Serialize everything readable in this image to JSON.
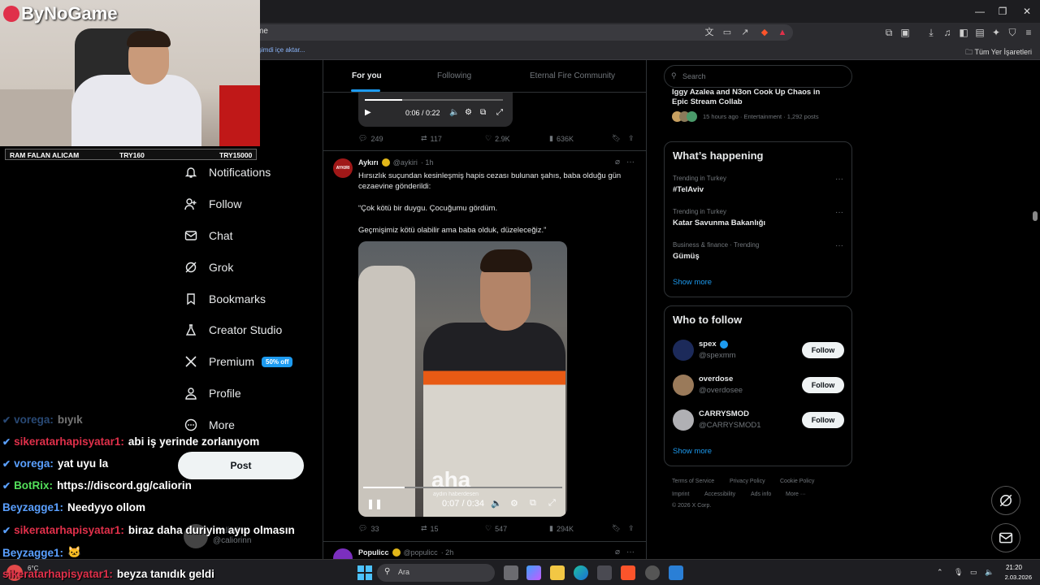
{
  "browser": {
    "address_text": "me",
    "bookmark_import": "şimdi içe aktar...",
    "all_bookmarks": "Tüm Yer İşaretleri",
    "window_controls": [
      "minimize-icon",
      "maximize-icon",
      "close-icon"
    ]
  },
  "webcam": {
    "logo": "ByNoGame",
    "ticker_left": "RAM FALAN ALICAM",
    "ticker_mid": "TRY160",
    "ticker_right": "TRY15000"
  },
  "nav": {
    "items": [
      {
        "label": "Notifications",
        "icon": "bell-icon"
      },
      {
        "label": "Follow",
        "icon": "person-add-icon"
      },
      {
        "label": "Chat",
        "icon": "mail-icon"
      },
      {
        "label": "Grok",
        "icon": "grok-icon"
      },
      {
        "label": "Bookmarks",
        "icon": "bookmark-icon"
      },
      {
        "label": "Creator Studio",
        "icon": "flask-icon"
      },
      {
        "label": "Premium",
        "icon": "x-logo-icon",
        "badge": "50% off"
      },
      {
        "label": "Profile",
        "icon": "person-icon"
      },
      {
        "label": "More",
        "icon": "more-circle-icon"
      }
    ],
    "post_label": "Post",
    "account_name": "Caliorinn",
    "account_handle": "@caliorinn"
  },
  "timeline": {
    "tabs": [
      "For you",
      "Following",
      "Eternal Fire Community"
    ],
    "active_tab": "For you",
    "prev_video": {
      "time": "0:06 / 0:22",
      "progress": 0.27
    },
    "prev_actions": {
      "replies": "249",
      "reposts": "117",
      "likes": "2.9K",
      "views": "636K"
    },
    "tweet": {
      "name": "Aykırı",
      "avatar_text": "AYKIRI",
      "handle": "@aykiri",
      "time": "· 1h",
      "line1": "Hırsızlık suçundan kesinleşmiş hapis cezası bulunan şahıs, baba olduğu gün cezaevine gönderildi:",
      "line2": "“Çok kötü bir duygu. Çocuğumu gördüm.",
      "line3": "Geçmişimiz kötü olabilir ama baba olduk, düzeleceğiz.”",
      "video_watermark": "aha",
      "video_watermark_sub": "aydın haberdesen",
      "video_time": "0:07 / 0:34",
      "video_progress": 0.21,
      "replies": "33",
      "reposts": "15",
      "likes": "547",
      "views": "294K"
    },
    "next_tweet": {
      "name": "Populicc",
      "handle": "@populicc",
      "time": "· 2h"
    }
  },
  "sidebar": {
    "search_placeholder": "Search",
    "news": {
      "title_line1": "Iggy Azalea and N3on Cook Up Chaos in",
      "title_line2": "Epic Stream Collab",
      "meta": "15 hours ago · Entertainment · 1,292 posts"
    },
    "happening": {
      "title": "What’s happening",
      "trends": [
        {
          "meta": "Trending in Turkey",
          "name": "#TelAviv"
        },
        {
          "meta": "Trending in Turkey",
          "name": "Katar Savunma Bakanlığı"
        },
        {
          "meta": "Business & finance · Trending",
          "name": "Gümüş"
        }
      ],
      "show_more": "Show more"
    },
    "who_to_follow": {
      "title": "Who to follow",
      "users": [
        {
          "name": "spex",
          "handle": "@spexmm",
          "button": "Follow"
        },
        {
          "name": "overdose",
          "handle": "@overdosee",
          "button": "Follow"
        },
        {
          "name": "CARRYSMOD",
          "handle": "@CARRYSMOD1",
          "button": "Follow"
        }
      ],
      "show_more": "Show more"
    },
    "footer": {
      "links": [
        "Terms of Service",
        "Privacy Policy",
        "Cookie Policy",
        "Imprint",
        "Accessibility",
        "Ads info",
        "More ···"
      ],
      "copyright": "© 2026 X Corp."
    }
  },
  "chat": [
    {
      "user": "vorega:",
      "msg": "bıyık",
      "color": "#5aa0ff",
      "faded": true
    },
    {
      "user": "sikeratarhapisyatar1:",
      "msg": "abi iş yerinde zorlanıyom",
      "color": "#e0304a"
    },
    {
      "user": "vorega:",
      "msg": "yat uyu la",
      "color": "#5aa0ff"
    },
    {
      "user": "BotRix:",
      "msg": "https://discord.gg/caliorin",
      "color": "#53e05a"
    },
    {
      "user": "Beyzagge1:",
      "msg": "Needyyo ollom",
      "color": "#5aa0ff"
    },
    {
      "user": "sikeratarhapisyatar1:",
      "msg": "biraz daha duriyim ayıp olmasın",
      "color": "#e0304a"
    },
    {
      "user": "Beyzagge1:",
      "msg": "🐱",
      "color": "#5aa0ff"
    },
    {
      "user": "sikeratarhapisyatar1:",
      "msg": "beyza tanıdık geldi",
      "color": "#e0304a"
    }
  ],
  "taskbar": {
    "search_placeholder": "Ara",
    "weather": "6°C",
    "time": "21:20",
    "date": "2.03.2026"
  }
}
